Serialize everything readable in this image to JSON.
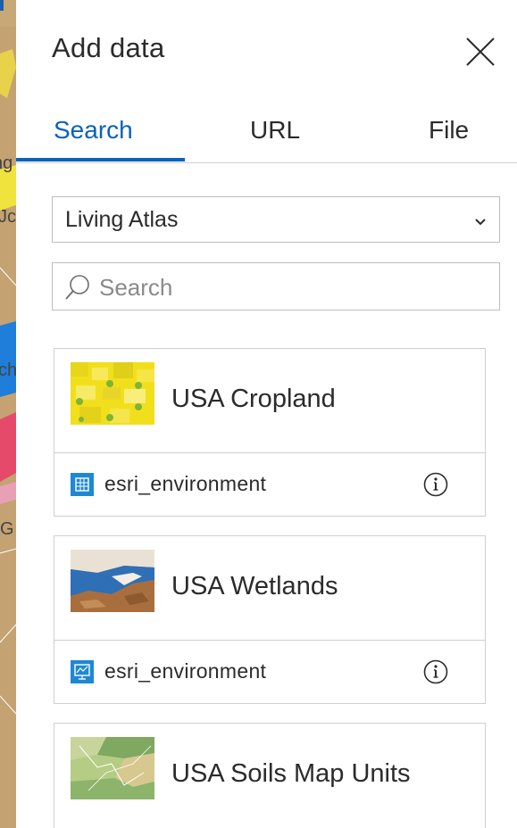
{
  "map": {
    "labels": [
      "ng",
      "Jc",
      "ch",
      "G"
    ]
  },
  "panel": {
    "title": "Add data"
  },
  "tabs": [
    {
      "label": "Search",
      "active": true
    },
    {
      "label": "URL",
      "active": false
    },
    {
      "label": "File",
      "active": false
    }
  ],
  "source_select": {
    "selected": "Living Atlas"
  },
  "search": {
    "placeholder": "Search",
    "value": ""
  },
  "results": [
    {
      "title": "USA Cropland",
      "owner": "esri_environment",
      "thumb": "cropland-thumbnail",
      "owner_icon": "image-service-icon"
    },
    {
      "title": "USA Wetlands",
      "owner": "esri_environment",
      "thumb": "wetlands-thumbnail",
      "owner_icon": "map-service-icon"
    },
    {
      "title": "USA Soils Map Units",
      "thumb": "soils-thumbnail"
    }
  ],
  "colors": {
    "accent": "#0a63b8",
    "border": "#cfcfcf",
    "owner_icon_bg": "#1e88d4",
    "text": "#2b2b2b"
  }
}
